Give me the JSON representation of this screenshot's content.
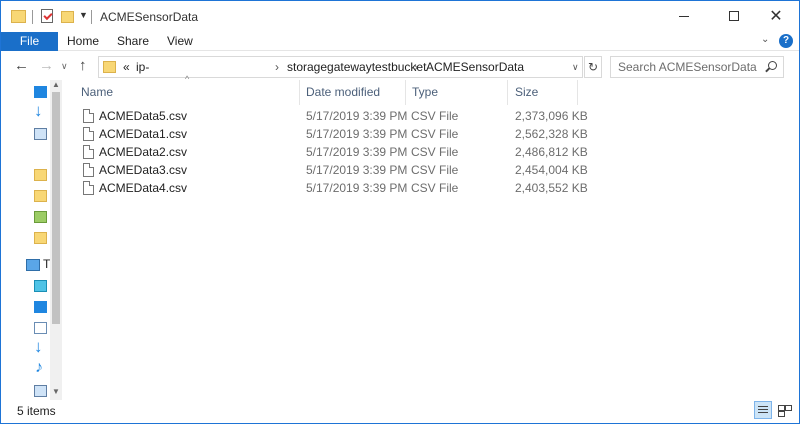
{
  "window": {
    "title": "ACMESensorData",
    "min_label": "—",
    "close_label": "✕"
  },
  "ribbon": {
    "file": "File",
    "tabs": [
      "Home",
      "Share",
      "View"
    ],
    "help": "?"
  },
  "address": {
    "prefix": "«",
    "segments": [
      "ip-",
      "storagegatewaytestbucket",
      "ACMESensorData"
    ],
    "separator": "›"
  },
  "search": {
    "placeholder": "Search ACMESensorData"
  },
  "nav_pane": {
    "truncated_label": "T"
  },
  "columns": {
    "name": "Name",
    "date": "Date modified",
    "type": "Type",
    "size": "Size"
  },
  "files": [
    {
      "name": "ACMEData5.csv",
      "date": "5/17/2019 3:39 PM",
      "type": "CSV File",
      "size": "2,373,096 KB"
    },
    {
      "name": "ACMEData1.csv",
      "date": "5/17/2019 3:39 PM",
      "type": "CSV File",
      "size": "2,562,328 KB"
    },
    {
      "name": "ACMEData2.csv",
      "date": "5/17/2019 3:39 PM",
      "type": "CSV File",
      "size": "2,486,812 KB"
    },
    {
      "name": "ACMEData3.csv",
      "date": "5/17/2019 3:39 PM",
      "type": "CSV File",
      "size": "2,454,004 KB"
    },
    {
      "name": "ACMEData4.csv",
      "date": "5/17/2019 3:39 PM",
      "type": "CSV File",
      "size": "2,403,552 KB"
    }
  ],
  "status": {
    "count": "5 items"
  },
  "colors": {
    "accent": "#1a6fc9",
    "folder": "#f8d775",
    "header_text": "#4c607a"
  }
}
